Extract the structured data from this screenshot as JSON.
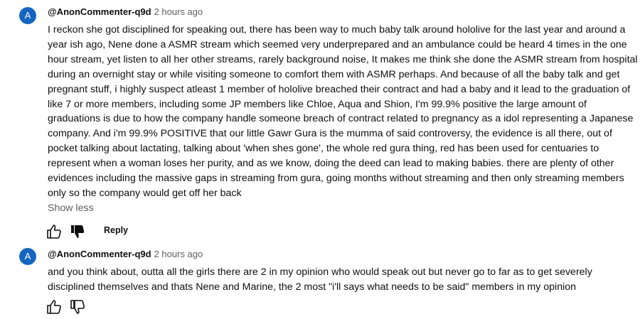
{
  "comments": [
    {
      "avatar_letter": "A",
      "author": "@AnonCommenter-q9d",
      "time": "2 hours ago",
      "text": "I reckon she got disciplined for speaking out, there has been way to much baby talk around hololive for the last year and around a year ish ago, Nene done a ASMR stream which seemed very underprepared and an ambulance could be heard 4 times in the one hour stream, yet listen to all her other streams, rarely background noise, It makes me think she done the ASMR stream from hospital during an overnight stay or while visiting someone to comfort them with ASMR perhaps. And because of all the baby talk and get pregnant stuff, i highly suspect atleast 1 member of hololive breached their contract and had a baby and it lead to the graduation of like 7 or more members, including some JP members like Chloe, Aqua and Shion, I'm 99.9% positive the large amount of graduations is due to how the company handle someone breach of contract related to pregnancy as a idol representing a Japanese company. And i'm 99.9% POSITIVE that our little Gawr Gura is the mumma of said controversy, the evidence is all there, out of pocket talking about lactating, talking about 'when shes gone', the whole red gura thing, red has been used for centuaries to represent when a woman loses her purity, and as we know, doing the deed can lead to making babies. there are plenty of other evidences including the massive gaps in streaming from gura, going months without streaming and then only streaming members only so the company would get off her back",
      "show_less": "Show less",
      "reply_label": "Reply"
    },
    {
      "avatar_letter": "A",
      "author": "@AnonCommenter-q9d",
      "time": "2 hours ago",
      "text": "and you think about, outta all the girls there are 2 in my opinion who would speak out but never go to far as to get severely disciplined themselves and thats Nene and Marine, the 2 most \"i'll says what needs to be said\" members in my opinion"
    }
  ],
  "icons": {
    "like": "thumb-up-outline-icon",
    "dislike": "thumb-down-filled-icon"
  },
  "colors": {
    "avatar_bg": "#1565c0",
    "secondary_text": "#606060",
    "primary_text": "#0f0f0f"
  }
}
